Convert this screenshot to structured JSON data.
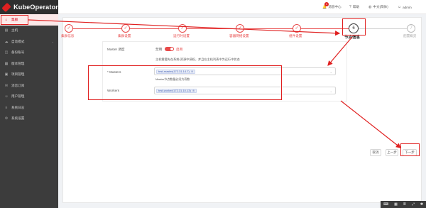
{
  "app": {
    "name": "KubeOperator"
  },
  "sidebar": {
    "items": [
      {
        "label": "集群",
        "icon": "home-icon",
        "active": true
      },
      {
        "label": "主机",
        "icon": "server-icon"
      },
      {
        "label": "自动模式",
        "icon": "cloud-icon",
        "arrow": true
      },
      {
        "label": "备份账号",
        "icon": "backup-icon"
      },
      {
        "label": "版本管理",
        "icon": "version-icon"
      },
      {
        "label": "项目管理",
        "icon": "project-icon"
      },
      {
        "label": "消息订阅",
        "icon": "message-icon"
      },
      {
        "label": "用户管理",
        "icon": "user-icon"
      },
      {
        "label": "系统日志",
        "icon": "log-icon"
      },
      {
        "label": "系统设置",
        "icon": "settings-icon"
      }
    ]
  },
  "header": {
    "messages": {
      "label": "消息中心",
      "badge": "1"
    },
    "help": "帮助",
    "language": "中文(简体)",
    "user": "admin"
  },
  "steps": [
    {
      "num": "✓",
      "label": "集群信息",
      "state": "done"
    },
    {
      "num": "✓",
      "label": "集群设置",
      "state": "done"
    },
    {
      "num": "✓",
      "label": "运行时设置",
      "state": "done"
    },
    {
      "num": "✓",
      "label": "容器网络设置",
      "state": "done"
    },
    {
      "num": "✓",
      "label": "组件设置",
      "state": "done"
    },
    {
      "num": "6",
      "label": "节点信息",
      "state": "current"
    },
    {
      "num": "7",
      "label": "配置概览",
      "state": "pending"
    }
  ],
  "form": {
    "master_schedule_label": "Master 调度",
    "master_schedule_off": "禁用",
    "master_schedule_on": "启用",
    "hint": "主机需要先在系统-资源中授权，并且在主机列表中为运行中状态",
    "masters_label": "* Masters",
    "masters_value": "test-master(172.31.14.7)",
    "masters_placeholder": "Master节点数量必须为奇数",
    "workers_label": "Workers",
    "workers_value": "test-worker(172.31.10.13)"
  },
  "buttons": {
    "cancel": "取消",
    "prev": "上一步",
    "next": "下一步"
  },
  "colors": {
    "accent": "#e84a4a",
    "annotation": "#e02020",
    "sidebar": "#3c3c3c"
  }
}
